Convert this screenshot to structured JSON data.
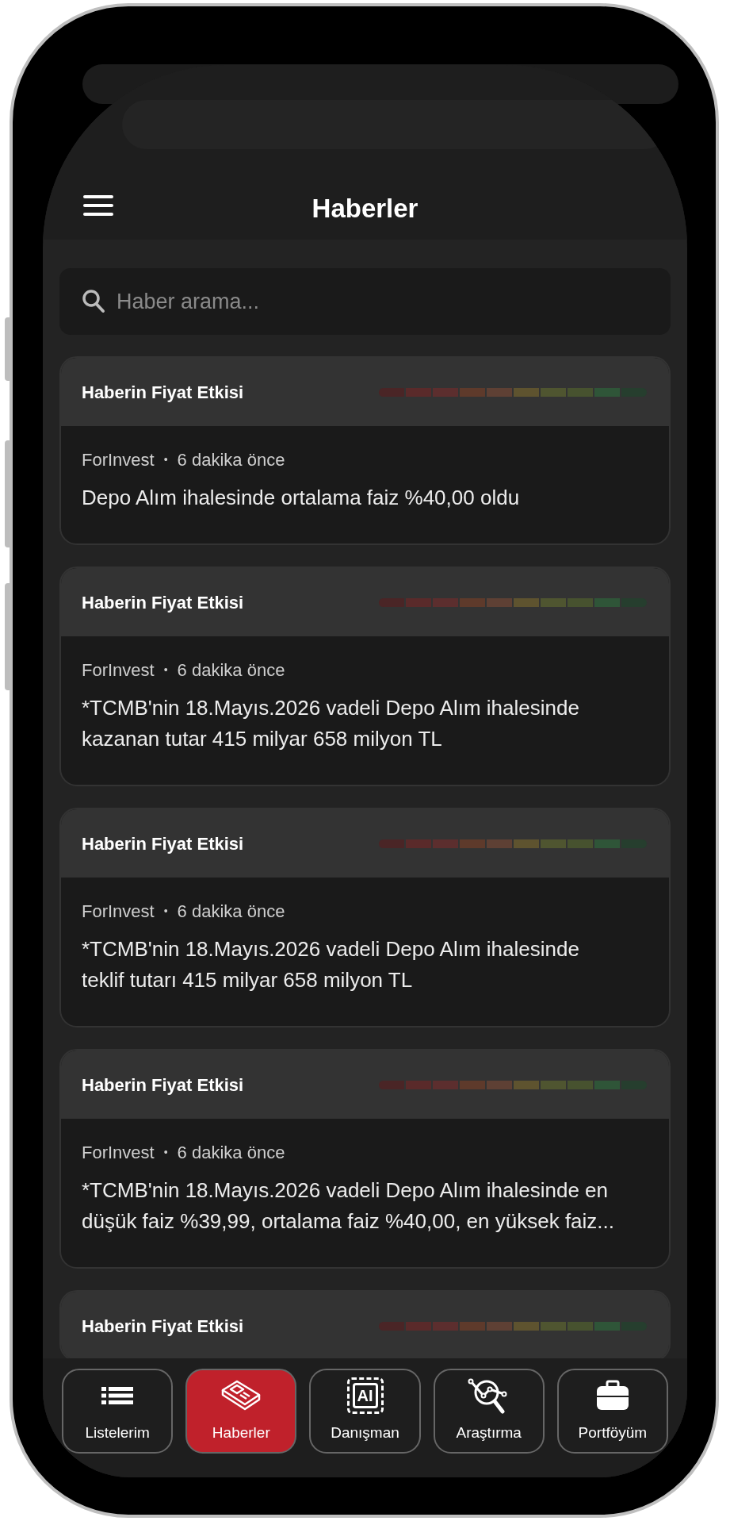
{
  "header": {
    "title": "Haberler"
  },
  "search": {
    "placeholder": "Haber arama..."
  },
  "cards": [
    {
      "impact_title": "Haberin Fiyat Etkisi",
      "impact_scale": [
        {
          "color": "#4a2526"
        },
        {
          "color": "#5a2a2a"
        },
        {
          "color": "#5c2e2e"
        },
        {
          "color": "#5e3a2b"
        },
        {
          "color": "#5e4034"
        },
        {
          "color": "#5e532f"
        },
        {
          "color": "#4f5530"
        },
        {
          "color": "#47522f"
        },
        {
          "color": "#2f5538"
        },
        {
          "color": "#263e2e"
        }
      ],
      "source": "ForInvest",
      "separator": "•",
      "time": "6 dakika önce",
      "headline": "Depo Alım ihalesinde ortalama faiz %40,00 oldu"
    },
    {
      "impact_title": "Haberin Fiyat Etkisi",
      "impact_scale": [
        {
          "color": "#4a2526"
        },
        {
          "color": "#5a2a2a"
        },
        {
          "color": "#5c2e2e"
        },
        {
          "color": "#5e3a2b"
        },
        {
          "color": "#5e4034"
        },
        {
          "color": "#5e532f"
        },
        {
          "color": "#4f5530"
        },
        {
          "color": "#47522f"
        },
        {
          "color": "#2f5538"
        },
        {
          "color": "#263e2e"
        }
      ],
      "source": "ForInvest",
      "separator": "•",
      "time": "6 dakika önce",
      "headline": "*TCMB'nin 18.Mayıs.2026 vadeli Depo Alım ihalesinde kazanan tutar 415 milyar 658 milyon TL"
    },
    {
      "impact_title": "Haberin Fiyat Etkisi",
      "impact_scale": [
        {
          "color": "#4a2526"
        },
        {
          "color": "#5a2a2a"
        },
        {
          "color": "#5c2e2e"
        },
        {
          "color": "#5e3a2b"
        },
        {
          "color": "#5e4034"
        },
        {
          "color": "#5e532f"
        },
        {
          "color": "#4f5530"
        },
        {
          "color": "#47522f"
        },
        {
          "color": "#2f5538"
        },
        {
          "color": "#263e2e"
        }
      ],
      "source": "ForInvest",
      "separator": "•",
      "time": "6 dakika önce",
      "headline": "*TCMB'nin 18.Mayıs.2026 vadeli Depo Alım ihalesinde teklif tutarı 415 milyar 658 milyon TL"
    },
    {
      "impact_title": "Haberin Fiyat Etkisi",
      "impact_scale": [
        {
          "color": "#4a2526"
        },
        {
          "color": "#5a2a2a"
        },
        {
          "color": "#5c2e2e"
        },
        {
          "color": "#5e3a2b"
        },
        {
          "color": "#5e4034"
        },
        {
          "color": "#5e532f"
        },
        {
          "color": "#4f5530"
        },
        {
          "color": "#47522f"
        },
        {
          "color": "#2f5538"
        },
        {
          "color": "#263e2e"
        }
      ],
      "source": "ForInvest",
      "separator": "•",
      "time": "6 dakika önce",
      "headline": "*TCMB'nin 18.Mayıs.2026 vadeli Depo Alım ihalesinde en düşük faiz %39,99, ortalama faiz %40,00, en yüksek faiz..."
    },
    {
      "impact_title": "Haberin Fiyat Etkisi",
      "impact_scale": [
        {
          "color": "#4a2526"
        },
        {
          "color": "#5a2a2a"
        },
        {
          "color": "#5c2e2e"
        },
        {
          "color": "#5e3a2b"
        },
        {
          "color": "#5e4034"
        },
        {
          "color": "#5e532f"
        },
        {
          "color": "#4f5530"
        },
        {
          "color": "#47522f"
        },
        {
          "color": "#2f5538"
        },
        {
          "color": "#263e2e"
        }
      ]
    }
  ],
  "bottom_nav": [
    {
      "label": "Listelerim",
      "kind": "list",
      "selected": false
    },
    {
      "label": "Haberler",
      "kind": "news",
      "selected": true
    },
    {
      "label": "Danışman",
      "kind": "chip",
      "icon_label": "AI",
      "selected": false
    },
    {
      "label": "Araştırma",
      "kind": "research",
      "selected": false
    },
    {
      "label": "Portföyüm",
      "kind": "briefcase",
      "selected": false
    }
  ]
}
